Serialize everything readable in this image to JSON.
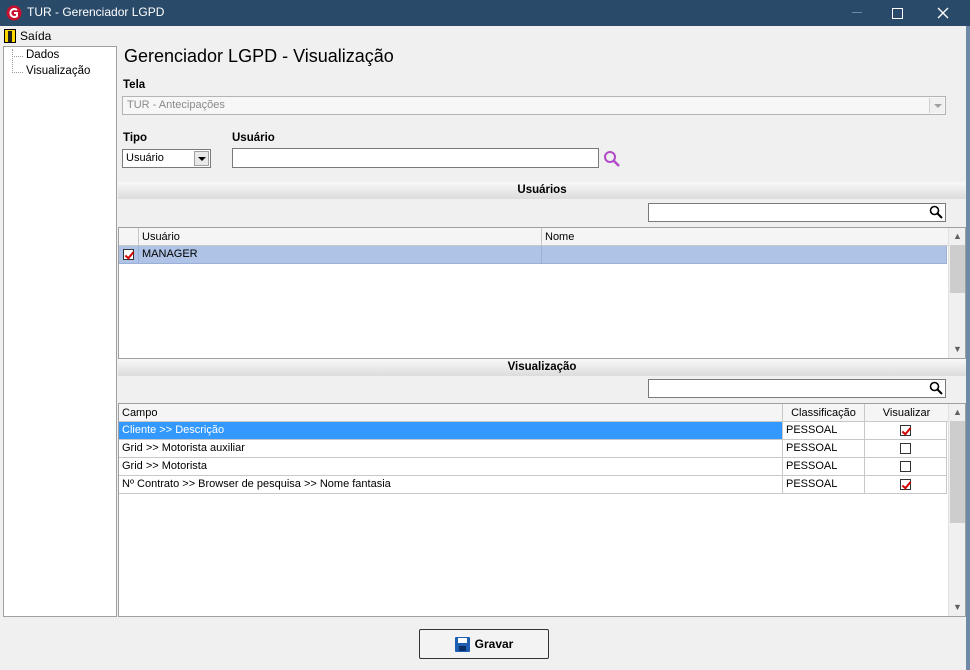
{
  "window": {
    "title": "TUR - Gerenciador LGPD"
  },
  "menu": {
    "exit_label": "Saída"
  },
  "tree": {
    "items": [
      {
        "label": "Dados"
      },
      {
        "label": "Visualização"
      }
    ]
  },
  "page": {
    "title": "Gerenciador LGPD - Visualização"
  },
  "tela": {
    "label": "Tela",
    "value": "TUR - Antecipações"
  },
  "tipo": {
    "label": "Tipo",
    "value": "Usuário"
  },
  "usuario": {
    "label": "Usuário",
    "value": ""
  },
  "usuarios_section": {
    "title": "Usuários",
    "filter_value": "",
    "columns": [
      "Usuário",
      "Nome"
    ],
    "rows": [
      {
        "checked": true,
        "usuario": "MANAGER",
        "nome": ""
      }
    ]
  },
  "visualizacao_section": {
    "title": "Visualização",
    "filter_value": "",
    "columns": [
      "Campo",
      "Classificação",
      "Visualizar"
    ],
    "rows": [
      {
        "campo": "Cliente >> Descrição",
        "classificacao": "PESSOAL",
        "visualizar": true
      },
      {
        "campo": "Grid  >> Motorista auxiliar",
        "classificacao": "PESSOAL",
        "visualizar": false
      },
      {
        "campo": "Grid >> Motorista",
        "classificacao": "PESSOAL",
        "visualizar": false
      },
      {
        "campo": "Nº Contrato >> Browser de pesquisa >> Nome fantasia",
        "classificacao": "PESSOAL",
        "visualizar": true
      }
    ]
  },
  "actions": {
    "save_label": "Gravar"
  },
  "icons": {
    "app": "app-logo-icon",
    "exit": "exit-door-icon",
    "search": "magnifier-icon",
    "save": "floppy-disk-icon"
  },
  "colors": {
    "titlebar": "#2a4a6a",
    "selected_row": "#3399ff",
    "highlight_row": "#aec3e6",
    "checkmark": "#d40000"
  }
}
